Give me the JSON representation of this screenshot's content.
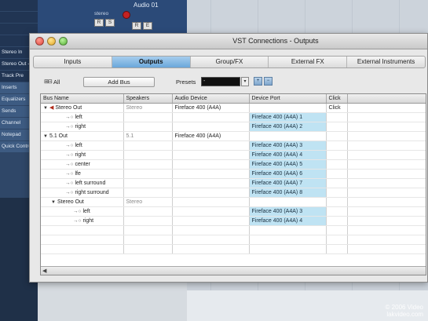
{
  "background": {
    "inspector_items": [
      {
        "label": "",
        "style": "dark"
      },
      {
        "label": "",
        "style": "dark"
      },
      {
        "label": "",
        "style": "dark"
      },
      {
        "label": "",
        "style": "dark"
      },
      {
        "label": "Stereo In",
        "style": "dark"
      },
      {
        "label": "Stereo Out - S",
        "style": "dark"
      },
      {
        "label": "Track Pre",
        "style": "dark"
      },
      {
        "label": "Inserts",
        "style": "mid"
      },
      {
        "label": "Equalizers",
        "style": "mid"
      },
      {
        "label": "Sends",
        "style": "mid"
      },
      {
        "label": "Channel",
        "style": "mid"
      },
      {
        "label": "Notepad",
        "style": "mid"
      },
      {
        "label": "Quick Controls",
        "style": "mid"
      }
    ],
    "track": {
      "name": "Audio 01",
      "sub": "stereo",
      "buttons": [
        "R",
        "S",
        "R",
        "E"
      ]
    },
    "watermark": {
      "line1": "© 2006 Video",
      "line2": "lakvideo.com"
    }
  },
  "window": {
    "title": "VST Connections - Outputs",
    "tabs": [
      {
        "label": "Inputs",
        "active": false
      },
      {
        "label": "Outputs",
        "active": true
      },
      {
        "label": "Group/FX",
        "active": false
      },
      {
        "label": "External FX",
        "active": false
      },
      {
        "label": "External Instruments",
        "active": false
      }
    ],
    "toolbar": {
      "expand_icons": "⊞⊟",
      "all_label": "All",
      "add_bus_label": "Add Bus",
      "presets_label": "Presets",
      "preset_value": "-",
      "preset_arrow": "▾"
    },
    "columns": [
      "Bus Name",
      "Speakers",
      "Audio Device",
      "Device Port",
      "Click"
    ],
    "rows": [
      {
        "indent": 0,
        "expander": "▼",
        "icon": "speaker",
        "name": "Stereo Out",
        "speakers": "Stereo",
        "device": "Fireface 400 (A4A)",
        "port": "",
        "click": "Click"
      },
      {
        "indent": 2,
        "expander": "",
        "icon": "connector",
        "name": "left",
        "speakers": "",
        "device": "",
        "port": "Fireface 400 (A4A) 1",
        "click": ""
      },
      {
        "indent": 2,
        "expander": "",
        "icon": "connector",
        "name": "right",
        "speakers": "",
        "device": "",
        "port": "Fireface 400 (A4A) 2",
        "click": ""
      },
      {
        "indent": 0,
        "expander": "▼",
        "icon": "",
        "name": "5.1 Out",
        "speakers": "5.1",
        "device": "Fireface 400 (A4A)",
        "port": "",
        "click": ""
      },
      {
        "indent": 2,
        "expander": "",
        "icon": "connector",
        "name": "left",
        "speakers": "",
        "device": "",
        "port": "Fireface 400 (A4A) 3",
        "click": ""
      },
      {
        "indent": 2,
        "expander": "",
        "icon": "connector",
        "name": "right",
        "speakers": "",
        "device": "",
        "port": "Fireface 400 (A4A) 4",
        "click": ""
      },
      {
        "indent": 2,
        "expander": "",
        "icon": "connector",
        "name": "center",
        "speakers": "",
        "device": "",
        "port": "Fireface 400 (A4A) 5",
        "click": ""
      },
      {
        "indent": 2,
        "expander": "",
        "icon": "connector",
        "name": "lfe",
        "speakers": "",
        "device": "",
        "port": "Fireface 400 (A4A) 6",
        "click": ""
      },
      {
        "indent": 2,
        "expander": "",
        "icon": "connector",
        "name": "left surround",
        "speakers": "",
        "device": "",
        "port": "Fireface 400 (A4A) 7",
        "click": ""
      },
      {
        "indent": 2,
        "expander": "",
        "icon": "connector",
        "name": "right surround",
        "speakers": "",
        "device": "",
        "port": "Fireface 400 (A4A) 8",
        "click": ""
      },
      {
        "indent": 1,
        "expander": "▼",
        "icon": "",
        "name": "Stereo Out",
        "speakers": "Stereo",
        "device": "",
        "port": "",
        "click": ""
      },
      {
        "indent": 3,
        "expander": "",
        "icon": "connector",
        "name": "left",
        "speakers": "",
        "device": "",
        "port": "Fireface 400 (A4A) 3",
        "click": ""
      },
      {
        "indent": 3,
        "expander": "",
        "icon": "connector",
        "name": "right",
        "speakers": "",
        "device": "",
        "port": "Fireface 400 (A4A) 4",
        "click": ""
      }
    ]
  }
}
